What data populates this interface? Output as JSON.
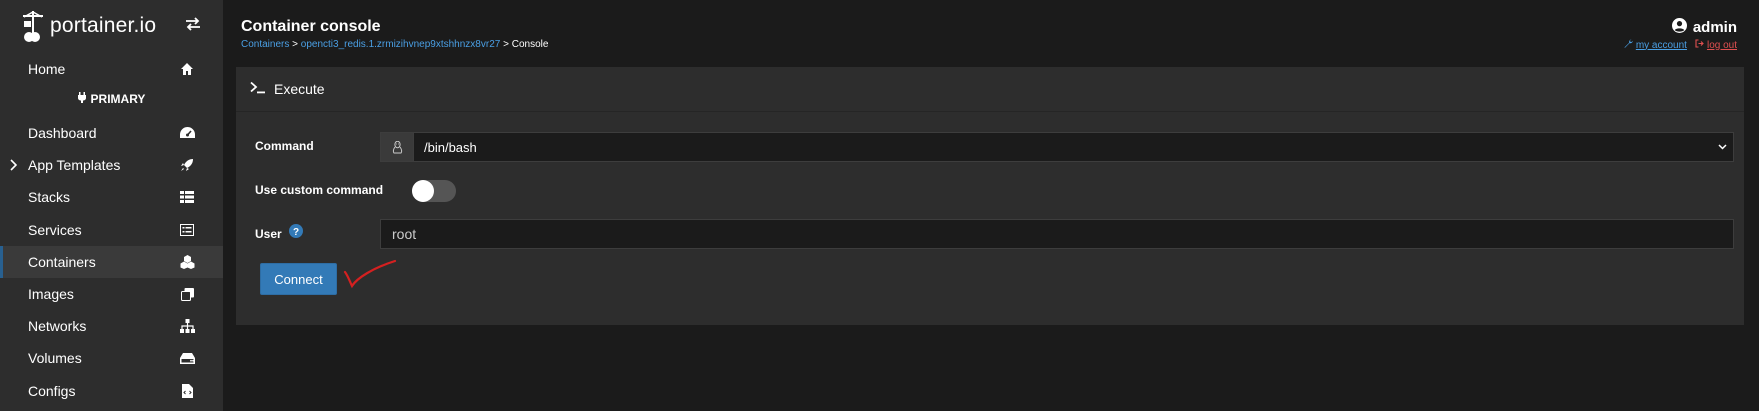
{
  "brand": {
    "name": "portainer.io"
  },
  "sidebar": {
    "environment": "PRIMARY",
    "items": [
      {
        "label": "Home",
        "icon": "home-icon"
      },
      {
        "label": "Dashboard",
        "icon": "tachometer-icon"
      },
      {
        "label": "App Templates",
        "icon": "rocket-icon"
      },
      {
        "label": "Stacks",
        "icon": "th-list-icon"
      },
      {
        "label": "Services",
        "icon": "list-alt-icon"
      },
      {
        "label": "Containers",
        "icon": "cubes-icon",
        "active": true
      },
      {
        "label": "Images",
        "icon": "clone-icon"
      },
      {
        "label": "Networks",
        "icon": "sitemap-icon"
      },
      {
        "label": "Volumes",
        "icon": "hdd-icon"
      },
      {
        "label": "Configs",
        "icon": "file-code-icon"
      }
    ]
  },
  "header": {
    "title": "Container console",
    "breadcrumb": {
      "root": "Containers",
      "sep1": ">",
      "container": "opencti3_redis.1.zrmizihvnep9xtshhnzx8vr27",
      "sep2": ">",
      "current": "Console"
    },
    "user": "admin",
    "my_account": "my account",
    "log_out": "log out"
  },
  "panel": {
    "title": "Execute",
    "command_label": "Command",
    "command_value": "/bin/bash",
    "custom_command_label": "Use custom command",
    "custom_command_enabled": false,
    "user_label": "User",
    "user_value": "root",
    "connect_label": "Connect"
  },
  "colors": {
    "accent": "#337ab7",
    "link": "#4a9fe4",
    "logout": "#e05050",
    "sidebar_bg": "#2d2d2d",
    "page_bg": "#1b1b1b",
    "annotation": "#d42020"
  }
}
